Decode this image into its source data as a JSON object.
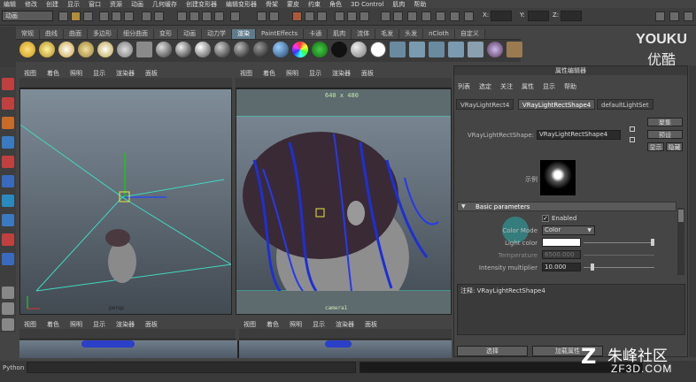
{
  "menubar": [
    "编辑",
    "修改",
    "创建",
    "显示",
    "窗口",
    "资源",
    "动画",
    "几何缓存",
    "创建变形器",
    "编辑变形器",
    "骨架",
    "蒙皮",
    "约束",
    "角色",
    "3D Control",
    "肌肉",
    "帮助"
  ],
  "status": {
    "mode": "动画",
    "x_label": "X:",
    "y_label": "Y:",
    "z_label": "Z:"
  },
  "shelf_tabs": [
    "常规",
    "曲线",
    "曲面",
    "多边形",
    "细分曲面",
    "变形",
    "动画",
    "动力学",
    "渲染",
    "PaintEffects",
    "卡通",
    "肌肉",
    "流体",
    "毛发",
    "头发",
    "nCloth",
    "自定义"
  ],
  "shelf_active": 8,
  "watermark_top": {
    "en": "YOUKU",
    "cn": "优酷"
  },
  "left_panel": {
    "menu": [
      "视图",
      "着色",
      "照明",
      "显示",
      "渲染器",
      "面板"
    ],
    "axis_label": "persp"
  },
  "right_panel": {
    "menu": [
      "视图",
      "着色",
      "照明",
      "显示",
      "渲染器",
      "面板"
    ],
    "resolution": "640 x 480",
    "camera_label": "camera1"
  },
  "bottom_panel": {
    "menu": [
      "视图",
      "着色",
      "照明",
      "显示",
      "渲染器",
      "面板"
    ],
    "menu_right": [
      "视图",
      "着色",
      "照明",
      "显示",
      "渲染器",
      "面板"
    ]
  },
  "attribute_editor": {
    "title": "属性编辑器",
    "menu": [
      "列表",
      "选定",
      "关注",
      "属性",
      "显示",
      "帮助"
    ],
    "tabs": [
      "VRayLightRect4",
      "VRayLightRectShape4",
      "defaultLightSet"
    ],
    "active_tab": 1,
    "buttons": {
      "focus": "聚集",
      "presets": "预设",
      "show": "显示",
      "hide": "隐藏"
    },
    "shape_label": "VRayLightRectShape:",
    "shape_value": "VRayLightRectShape4",
    "sample_label": "示例",
    "section": "Basic parameters",
    "enabled_label": "Enabled",
    "enabled_checked": true,
    "color_mode_label": "Color Mode",
    "color_mode_value": "Color",
    "light_color_label": "Light color",
    "light_color": "#ffffff",
    "temperature_label": "Temperature",
    "temperature_value": "6500.000",
    "intensity_label": "Intensity multiplier",
    "intensity_value": "10.000",
    "notes_label": "注释: VRayLightRectShape4",
    "select_button": "选择",
    "load_button": "加载属性"
  },
  "command_line": {
    "label": "Python"
  },
  "watermark_bottom": {
    "cn": "朱峰社区",
    "en": "ZF3D.COM"
  }
}
